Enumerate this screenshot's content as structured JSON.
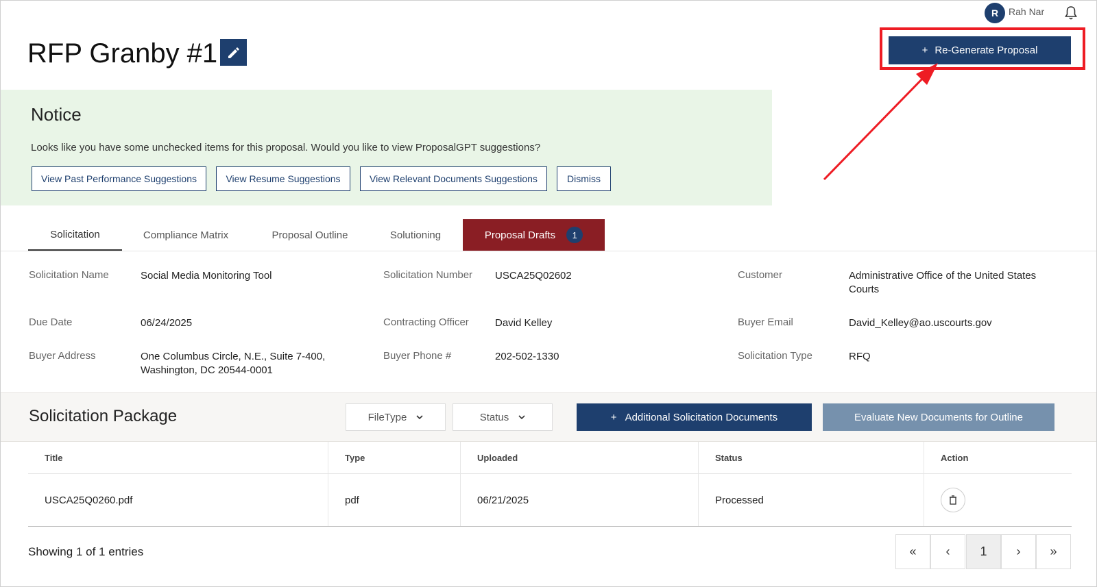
{
  "user": {
    "initial": "R",
    "name": "Rah Nar"
  },
  "page": {
    "title": "RFP Granby #1"
  },
  "actions": {
    "regenerate_icon": "+",
    "regenerate_label": "Re-Generate Proposal"
  },
  "notice": {
    "title": "Notice",
    "text": "Looks like you have some unchecked items for this proposal. Would you like to view ProposalGPT suggestions?",
    "buttons": [
      "View Past Performance Suggestions",
      "View Resume Suggestions",
      "View Relevant Documents Suggestions",
      "Dismiss"
    ]
  },
  "tabs": [
    {
      "label": "Solicitation"
    },
    {
      "label": "Compliance Matrix"
    },
    {
      "label": "Proposal Outline"
    },
    {
      "label": "Solutioning"
    },
    {
      "label": "Proposal Drafts",
      "badge": "1"
    }
  ],
  "details": {
    "solicitation_name": {
      "label": "Solicitation Name",
      "value": "Social Media Monitoring Tool"
    },
    "solicitation_number": {
      "label": "Solicitation Number",
      "value": "USCA25Q02602"
    },
    "customer": {
      "label": "Customer",
      "value": "Administrative Office of the United States Courts"
    },
    "due_date": {
      "label": "Due Date",
      "value": "06/24/2025"
    },
    "contracting_officer": {
      "label": "Contracting Officer",
      "value": "David Kelley"
    },
    "buyer_email": {
      "label": "Buyer Email",
      "value": "David_Kelley@ao.uscourts.gov"
    },
    "buyer_address": {
      "label": "Buyer Address",
      "value": "One Columbus Circle, N.E., Suite 7-400, Washington, DC 20544-0001"
    },
    "buyer_phone": {
      "label": "Buyer Phone #",
      "value": "202-502-1330"
    },
    "solicitation_type": {
      "label": "Solicitation Type",
      "value": "RFQ"
    }
  },
  "package": {
    "title": "Solicitation Package",
    "filetype_label": "FileType",
    "status_label": "Status",
    "add_icon": "+",
    "add_label": "Additional Solicitation Documents",
    "evaluate_label": "Evaluate New Documents for Outline",
    "columns": [
      "Title",
      "Type",
      "Uploaded",
      "Status",
      "Action"
    ],
    "rows": [
      {
        "title": "USCA25Q0260.pdf",
        "type": "pdf",
        "uploaded": "06/21/2025",
        "status": "Processed"
      }
    ],
    "showing": "Showing 1 of 1 entries"
  },
  "pagination": {
    "first": "«",
    "prev": "‹",
    "current": "1",
    "next": "›",
    "last": "»"
  },
  "colors": {
    "primary": "#1e3f6e",
    "drafts_tab": "#8a1e24",
    "notice_bg": "#e9f5e7",
    "highlight": "#ee1c24"
  }
}
